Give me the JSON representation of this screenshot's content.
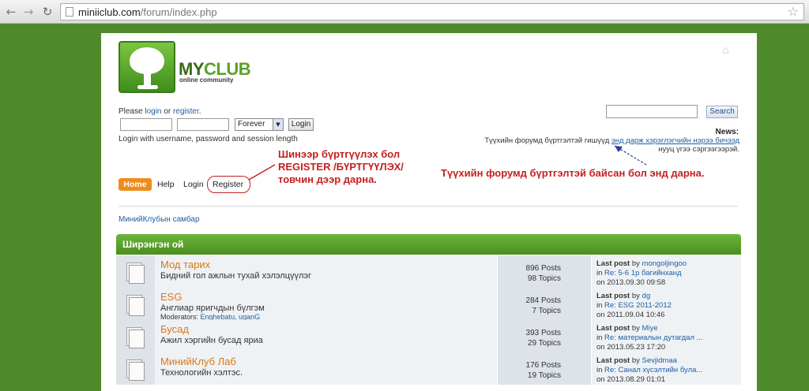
{
  "browser": {
    "back_icon": "←",
    "forward_icon": "→",
    "reload_icon": "↻",
    "url_host": "miniiclub.com",
    "url_path": "/forum/index.php",
    "star_icon": "☆"
  },
  "site": {
    "brand_my": "MY",
    "brand_club": "CLUB",
    "tagline": "online community",
    "corner_icon": "⌂"
  },
  "login": {
    "intro_prefix": "Please ",
    "intro_login": "login",
    "intro_or": " or ",
    "intro_register": "register",
    "intro_suffix": ".",
    "duration": "Forever",
    "button": "Login",
    "help": "Login with username, password and session length"
  },
  "search": {
    "button": "Search"
  },
  "news": {
    "title": "News:",
    "text_before": "Түүхийн форумд бүртгэлтэй гишүүд ",
    "link": "энд дарж хэрэглэгчийн нэрээ бичээд",
    "text_after": "нууц үгээ сэргээгээрэй."
  },
  "annotations": {
    "left": "Шинээр бүртгүүлэх бол REGISTER /БҮРТГҮҮЛЭХ/ товчин дээр дарна.",
    "right": "Түүхийн форумд бүртгэлтэй байсан бол энд дарна."
  },
  "nav": {
    "home": "Home",
    "help": "Help",
    "login": "Login",
    "register": "Register"
  },
  "breadcrumb": "МинийКлубын самбар",
  "category": "Ширэнгэн ой",
  "forums": [
    {
      "name": "Мод тарих",
      "desc": "Бидний гол ажлын тухай хэлэлцүүлэг",
      "moderators_label": "",
      "moderators": "",
      "posts": "896 Posts",
      "topics": "98 Topics",
      "last_label": "Last post",
      "by": " by ",
      "author": "mongoljingoo",
      "in": "in ",
      "topic": "Re: 5-6 1р багийнханд",
      "on": "on 2013.09.30 09:58"
    },
    {
      "name": "ESG",
      "desc": "Англиар яригчдын бүлгэм",
      "moderators_label": "Moderators: ",
      "moderators": "Enghebatu, uganG",
      "posts": "284 Posts",
      "topics": "7 Topics",
      "last_label": "Last post",
      "by": " by ",
      "author": "dg",
      "in": "in ",
      "topic": "Re: ESG 2011-2012",
      "on": "on 2011.09.04 10:46"
    },
    {
      "name": "Бусад",
      "desc": "Ажил хэргийн бусад яриа",
      "moderators_label": "",
      "moderators": "",
      "posts": "393 Posts",
      "topics": "29 Topics",
      "last_label": "Last post",
      "by": " by ",
      "author": "Miye",
      "in": "in ",
      "topic": "Re: материалын дутагдал ...",
      "on": "on 2013.05.23 17:20"
    },
    {
      "name": "МинийКлуб Лаб",
      "desc": "Технологийн хэлтэс.",
      "moderators_label": "",
      "moderators": "",
      "posts": "176 Posts",
      "topics": "19 Topics",
      "last_label": "Last post",
      "by": " by ",
      "author": "Sevjidmaa",
      "in": "in ",
      "topic": "Re: Санал хүсэлтийн була...",
      "on": "on 2013.08.29 01:01"
    }
  ],
  "colors": {
    "accent_green": "#5aa02a",
    "annotation_red": "#c42020",
    "forum_link_orange": "#d9781a",
    "link_blue": "#1f5fa3"
  }
}
